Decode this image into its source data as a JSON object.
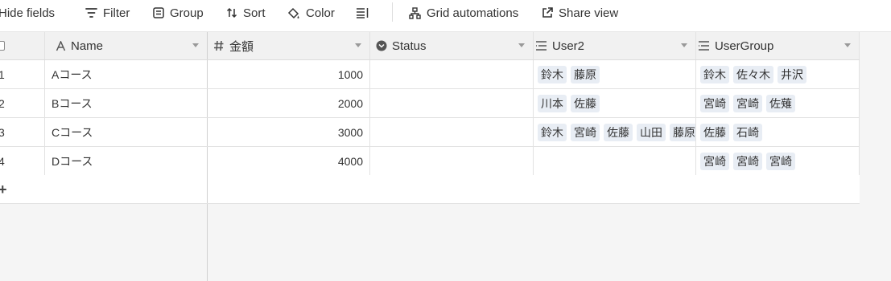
{
  "toolbar": {
    "hide_fields": "Hide fields",
    "filter": "Filter",
    "group": "Group",
    "sort": "Sort",
    "color": "Color",
    "grid_automations": "Grid automations",
    "share_view": "Share view"
  },
  "columns": {
    "name": "Name",
    "amount": "金額",
    "status": "Status",
    "user2": "User2",
    "usergroup": "UserGroup"
  },
  "rows": [
    {
      "index": "1",
      "name": "Aコース",
      "amount": "1000",
      "status": "",
      "user2": [
        "鈴木",
        "藤原"
      ],
      "usergroup": [
        "鈴木",
        "佐々木",
        "井沢"
      ]
    },
    {
      "index": "2",
      "name": "Bコース",
      "amount": "2000",
      "status": "",
      "user2": [
        "川本",
        "佐藤"
      ],
      "usergroup": [
        "宮崎",
        "宮崎",
        "佐薙"
      ]
    },
    {
      "index": "3",
      "name": "Cコース",
      "amount": "3000",
      "status": "",
      "user2": [
        "鈴木",
        "宮崎",
        "佐藤",
        "山田",
        "藤原"
      ],
      "usergroup": [
        "佐藤",
        "石崎"
      ]
    },
    {
      "index": "4",
      "name": "Dコース",
      "amount": "4000",
      "status": "",
      "user2": [],
      "usergroup": [
        "宮崎",
        "宮崎",
        "宮崎"
      ]
    }
  ],
  "add_row_label": "+"
}
